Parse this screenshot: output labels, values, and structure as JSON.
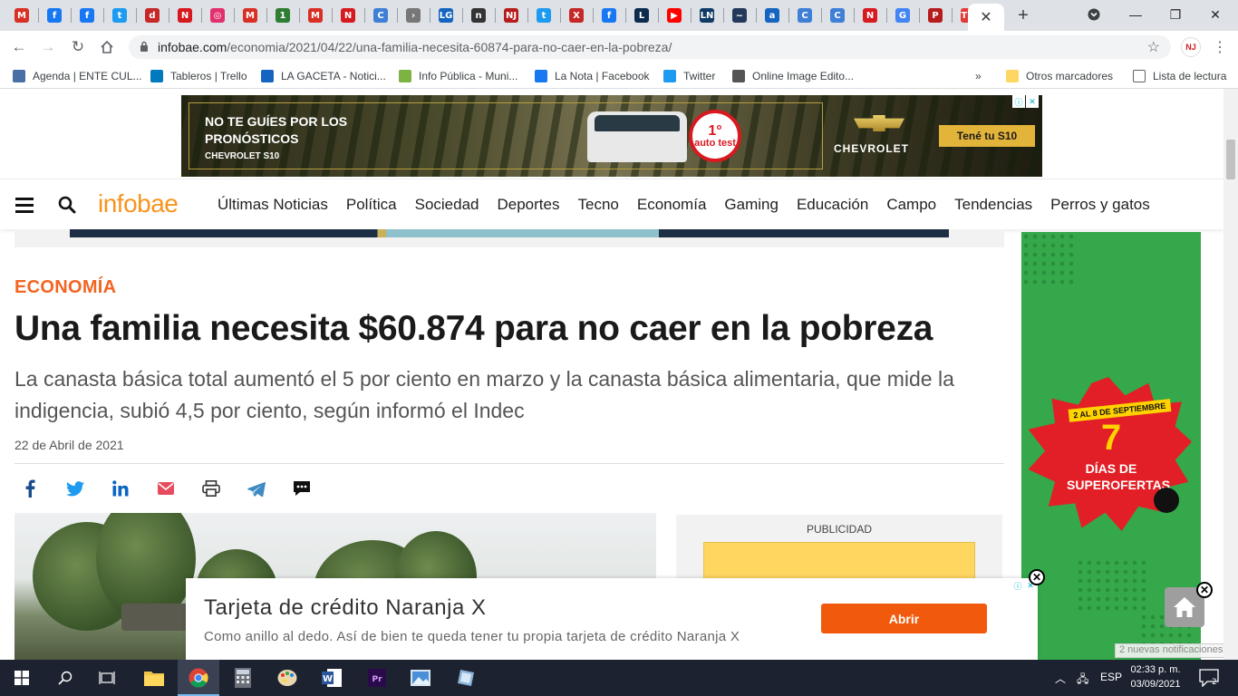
{
  "browser": {
    "tabs": [
      {
        "icon": "gmail-icon",
        "glyph": "M",
        "color": "#d93025"
      },
      {
        "icon": "facebook-icon",
        "glyph": "f",
        "color": "#1877f2"
      },
      {
        "icon": "facebook-icon",
        "glyph": "f",
        "color": "#1877f2"
      },
      {
        "icon": "twitter-icon",
        "glyph": "t",
        "color": "#1d9bf0"
      },
      {
        "icon": "news-site-icon",
        "glyph": "d",
        "color": "#c62828"
      },
      {
        "icon": "news-site-icon",
        "glyph": "N",
        "color": "#d71920"
      },
      {
        "icon": "instagram-icon",
        "glyph": "◎",
        "color": "#e1306c"
      },
      {
        "icon": "gmail-icon",
        "glyph": "M",
        "color": "#d93025"
      },
      {
        "icon": "news-site-icon",
        "glyph": "1",
        "color": "#2e7d32"
      },
      {
        "icon": "gmail-icon",
        "glyph": "M",
        "color": "#d93025"
      },
      {
        "icon": "news-site-icon",
        "glyph": "N",
        "color": "#d71920"
      },
      {
        "icon": "canva-icon",
        "glyph": "C",
        "color": "#3f7fd6"
      },
      {
        "icon": "arrow-circle-icon",
        "glyph": "›",
        "color": "#777777"
      },
      {
        "icon": "la-gaceta-icon",
        "glyph": "LG",
        "color": "#1565c0"
      },
      {
        "icon": "news-site-icon",
        "glyph": "n",
        "color": "#333333"
      },
      {
        "icon": "news-site-icon",
        "glyph": "NJ",
        "color": "#b71c1c"
      },
      {
        "icon": "twitter-icon",
        "glyph": "t",
        "color": "#1d9bf0"
      },
      {
        "icon": "news-site-icon",
        "glyph": "X",
        "color": "#c62828"
      },
      {
        "icon": "facebook-icon",
        "glyph": "f",
        "color": "#1877f2"
      },
      {
        "icon": "news-site-icon",
        "glyph": "L",
        "color": "#0d2b4e"
      },
      {
        "icon": "youtube-icon",
        "glyph": "▶",
        "color": "#ff0000"
      },
      {
        "icon": "la-nacion-icon",
        "glyph": "LN",
        "color": "#0f3b66"
      },
      {
        "icon": "news-site-icon",
        "glyph": "~",
        "color": "#22395c"
      },
      {
        "icon": "news-site-icon",
        "glyph": "a",
        "color": "#1565c0"
      },
      {
        "icon": "canva-icon",
        "glyph": "C",
        "color": "#3f7fd6"
      },
      {
        "icon": "canva-icon",
        "glyph": "C",
        "color": "#3f7fd6"
      },
      {
        "icon": "news-site-icon",
        "glyph": "N",
        "color": "#d71920"
      },
      {
        "icon": "google-icon",
        "glyph": "G",
        "color": "#4285f4"
      },
      {
        "icon": "news-site-icon",
        "glyph": "P",
        "color": "#b71c1c"
      },
      {
        "icon": "news-site-icon",
        "glyph": "TN",
        "color": "#e53935"
      }
    ],
    "active_tab_close": "✕",
    "new_tab": "+",
    "url_host": "infobae.com",
    "url_path": "/economia/2021/04/22/una-familia-necesita-60874-para-no-caer-en-la-pobreza/"
  },
  "bookmarks": {
    "items": [
      {
        "label": "Agenda | ENTE CUL...",
        "icon": "gear-icon",
        "color": "#4a6fa5"
      },
      {
        "label": "Tableros | Trello",
        "icon": "trello-icon",
        "color": "#0079bf"
      },
      {
        "label": "LA GACETA - Notici...",
        "icon": "la-gaceta-icon",
        "color": "#1565c0"
      },
      {
        "label": "Info Pública - Muni...",
        "icon": "info-icon",
        "color": "#7cb342"
      },
      {
        "label": "La Nota | Facebook",
        "icon": "facebook-icon",
        "color": "#1877f2"
      },
      {
        "label": "Twitter",
        "icon": "twitter-icon",
        "color": "#1d9bf0"
      },
      {
        "label": "Online Image Edito...",
        "icon": "aperture-icon",
        "color": "#555555"
      }
    ],
    "more": "»",
    "other": "Otros marcadores",
    "reading_list": "Lista de lectura"
  },
  "top_ad": {
    "headline": "NO TE GUÍES POR LOS PRONÓSTICOS",
    "model": "CHEVROLET S10",
    "badge_rank": "1°",
    "badge_text": "auto test",
    "brand": "CHEVROLET",
    "cta": "Tené tu S10"
  },
  "site": {
    "logo": "infobae",
    "nav": [
      "Últimas Noticias",
      "Política",
      "Sociedad",
      "Deportes",
      "Tecno",
      "Economía",
      "Gaming",
      "Educación",
      "Campo",
      "Tendencias",
      "Perros y gatos"
    ]
  },
  "article": {
    "section": "ECONOMÍA",
    "headline": "Una familia necesita $60.874 para no caer en la pobreza",
    "subhead": "La canasta básica total aumentó el 5 por ciento en marzo y la canasta básica alimentaria, que mide la indigencia, subió 4,5 por ciento, según informó el Indec",
    "date": "22 de Abril de 2021",
    "share": [
      "facebook-icon",
      "twitter-icon",
      "linkedin-icon",
      "email-icon",
      "print-icon",
      "telegram-icon",
      "comments-icon"
    ]
  },
  "publicidad": {
    "label": "PUBLICIDAD"
  },
  "side_ad": {
    "tag": "2 AL 8 DE SEPTIEMBRE",
    "number": "7",
    "text": "DÍAS DE SUPEROFERTAS"
  },
  "bottom_ad": {
    "title": "Tarjeta de crédito Naranja X",
    "description": "Como anillo al dedo. Así de bien te queda tener tu propia tarjeta de crédito Naranja X",
    "button": "Abrir"
  },
  "notification": "2 nuevas notificaciones",
  "taskbar": {
    "lang": "ESP",
    "time": "02:33 p. m.",
    "date": "03/09/2021",
    "notif_count": "2"
  }
}
